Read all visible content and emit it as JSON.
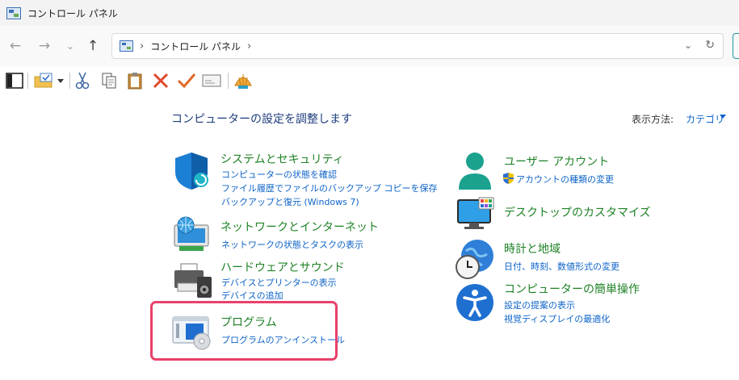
{
  "window": {
    "title": "コントロール パネル",
    "icon": "control-panel-icon"
  },
  "nav": {
    "breadcrumb": [
      "コントロール パネル"
    ],
    "back_icon": "arrow-left-icon",
    "forward_icon": "arrow-right-icon",
    "recent_icon": "chevron-down-icon",
    "up_icon": "arrow-up-icon",
    "refresh_icon": "refresh-icon"
  },
  "toolbar": {
    "items": [
      "layout-icon",
      "folder-check-icon",
      "dropdown-arrow-icon",
      "scissors-icon",
      "copy-icon",
      "clipboard-icon",
      "delete-x-icon",
      "checkmark-icon",
      "envelope-icon",
      "shell-icon"
    ]
  },
  "main": {
    "heading": "コンピューターの設定を調整します",
    "view_by_label": "表示方法:",
    "view_by_value": "カテゴリ"
  },
  "categories": {
    "system_security": {
      "title": "システムとセキュリティ",
      "links": [
        "コンピューターの状態を確認",
        "ファイル履歴でファイルのバックアップ コピーを保存",
        "バックアップと復元 (Windows 7)"
      ]
    },
    "network": {
      "title": "ネットワークとインターネット",
      "links": [
        "ネットワークの状態とタスクの表示"
      ]
    },
    "hardware_sound": {
      "title": "ハードウェアとサウンド",
      "links": [
        "デバイスとプリンターの表示",
        "デバイスの追加"
      ]
    },
    "programs": {
      "title": "プログラム",
      "links": [
        "プログラムのアンインストール"
      ]
    },
    "user_accounts": {
      "title": "ユーザー アカウント",
      "links": [
        "アカウントの種類の変更"
      ]
    },
    "appearance": {
      "title": "デスクトップのカスタマイズ",
      "links": []
    },
    "clock_region": {
      "title": "時計と地域",
      "links": [
        "日付、時刻、数値形式の変更"
      ]
    },
    "ease_of_access": {
      "title": "コンピューターの簡単操作",
      "links": [
        "設定の提案の表示",
        "視覚ディスプレイの最適化"
      ]
    }
  },
  "colors": {
    "title_green": "#1e8226",
    "link_blue": "#0e64c8",
    "heading_blue": "#1e3c7d",
    "highlight_pink": "#e8416b"
  }
}
